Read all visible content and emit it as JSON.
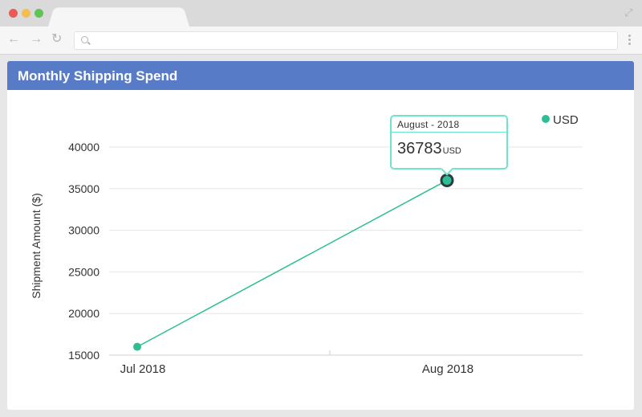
{
  "browser": {
    "back_icon": "back-arrow-icon",
    "forward_icon": "forward-arrow-icon",
    "reload_icon": "reload-icon",
    "address_value": "",
    "address_icon": "search-icon",
    "window_dots": [
      "#ee5a52",
      "#f5be4f",
      "#5ec454"
    ]
  },
  "panel": {
    "title": "Monthly Shipping Spend",
    "header_color": "#587bc8"
  },
  "tooltip": {
    "title": "August - 2018",
    "value": "36783",
    "unit": "USD"
  },
  "chart_data": {
    "type": "line",
    "categories": [
      "Jul 2018",
      "Aug 2018"
    ],
    "series": [
      {
        "name": "USD",
        "values": [
          16000,
          36000
        ],
        "color": "#2bbf93"
      }
    ],
    "ylabel": "Shipment Amount ($)",
    "xlabel": "",
    "ylim": [
      15000,
      40000
    ],
    "y_ticks": [
      15000,
      20000,
      25000,
      30000,
      35000,
      40000
    ],
    "grid": true,
    "legend": "top-right",
    "highlighted_index": 1
  }
}
